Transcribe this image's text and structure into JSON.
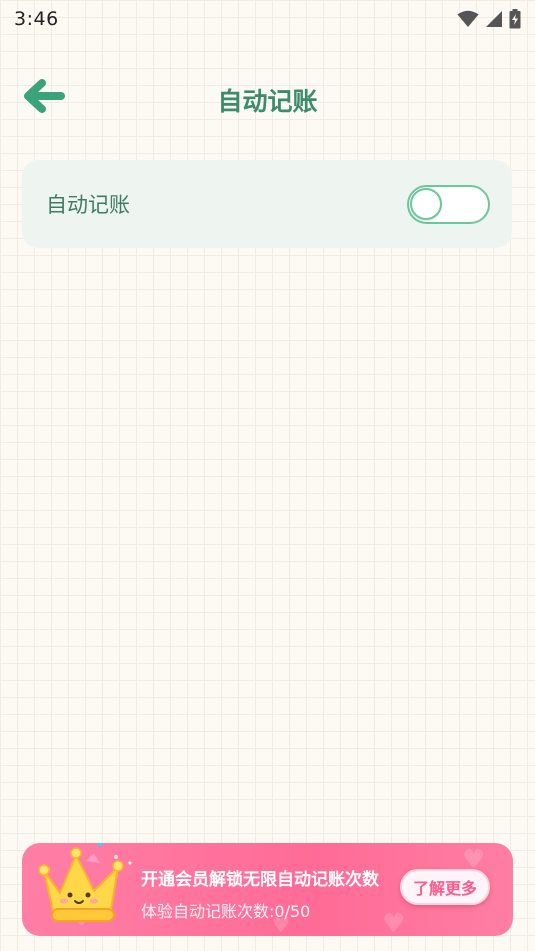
{
  "status_bar": {
    "time": "3:46",
    "icons": [
      "wifi-icon",
      "signal-icon",
      "battery-charging-icon"
    ]
  },
  "header": {
    "back_icon": "arrow-left-icon",
    "title": "自动记账"
  },
  "setting": {
    "label": "自动记账",
    "toggle_on": false
  },
  "promo": {
    "title": "开通会员解锁无限自动记账次数",
    "subtitle": "体验自动记账次数:0/50",
    "button_label": "了解更多",
    "icon": "crown-icon"
  },
  "colors": {
    "accent": "#3b8c6b",
    "toggle": "#6cc79e",
    "card": "#eef5f1",
    "promo": "#ff6b96"
  }
}
